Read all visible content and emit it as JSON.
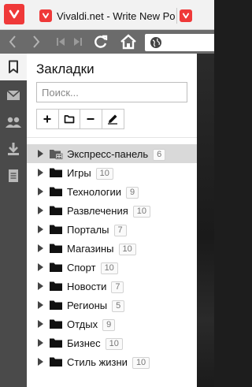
{
  "tabs": [
    {
      "title": "Vivaldi.net - Write New Post"
    },
    {
      "title": ""
    }
  ],
  "panel": {
    "title": "Закладки",
    "search_placeholder": "Поиск...",
    "toolbar": {
      "add_icon": "plus-icon",
      "folder_icon": "folder-icon",
      "remove_icon": "minus-icon",
      "edit_icon": "pencil-icon"
    }
  },
  "bookmarks": [
    {
      "name": "Экспресс-панель",
      "count": "6",
      "selected": true
    },
    {
      "name": "Игры",
      "count": "10"
    },
    {
      "name": "Технологии",
      "count": "9"
    },
    {
      "name": "Развлечения",
      "count": "10"
    },
    {
      "name": "Порталы",
      "count": "7"
    },
    {
      "name": "Магазины",
      "count": "10"
    },
    {
      "name": "Спорт",
      "count": "10"
    },
    {
      "name": "Новости",
      "count": "7"
    },
    {
      "name": "Регионы",
      "count": "5"
    },
    {
      "name": "Отдых",
      "count": "9"
    },
    {
      "name": "Бизнес",
      "count": "10"
    },
    {
      "name": "Стиль жизни",
      "count": "10"
    }
  ],
  "colors": {
    "brand": "#ef3939",
    "panel_strip": "#4a4a4a",
    "navbar": "#6b6b6b",
    "selected_row": "#d9d9d9"
  }
}
